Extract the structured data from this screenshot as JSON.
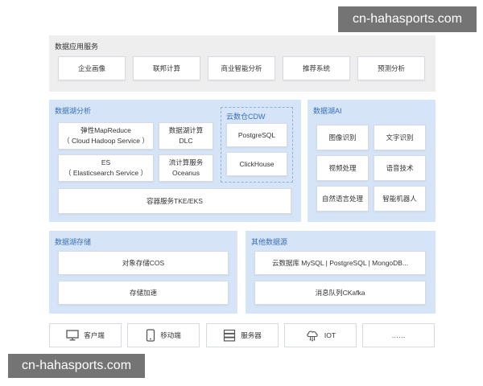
{
  "watermark_top": "cn-hahasports.com",
  "watermark_bottom": "cn-hahasports.com",
  "data_app_services": {
    "title": "数据应用服务",
    "items": [
      "企业画像",
      "联邦计算",
      "商业智能分析",
      "推荐系统",
      "预测分析"
    ]
  },
  "lake_analysis": {
    "title": "数据湖分析",
    "mapreduce": {
      "line1": "弹性MapReduce",
      "line2": "（ Cloud Hadoop Service ）"
    },
    "dlc": {
      "line1": "数据湖计算",
      "line2": "DLC"
    },
    "es": {
      "line1": "ES",
      "line2": "（ Elasticsearch Service ）"
    },
    "oceanus": {
      "line1": "流计算服务",
      "line2": "Oceanus"
    },
    "cdw": {
      "title": "云数仓CDW",
      "items": [
        "PostgreSQL",
        "ClickHouse"
      ]
    },
    "container": "容器服务TKE/EKS"
  },
  "lake_ai": {
    "title": "数据湖AI",
    "items": [
      "图像识别",
      "文字识别",
      "视频处理",
      "语音技术",
      "自然语言处理",
      "智能机器人"
    ]
  },
  "lake_storage": {
    "title": "数据湖存储",
    "items": [
      "对象存储COS",
      "存储加速"
    ]
  },
  "other_sources": {
    "title": "其他数据源",
    "items": [
      "云数据库 MySQL | PostgreSQL | MongoDB...",
      "消息队列CKafka"
    ]
  },
  "clients": [
    {
      "label": "客户端",
      "icon": "monitor-icon"
    },
    {
      "label": "移动端",
      "icon": "mobile-icon"
    },
    {
      "label": "服务器",
      "icon": "server-icon"
    },
    {
      "label": "IOT",
      "icon": "iot-cloud-icon"
    },
    {
      "label": "……",
      "icon": ""
    }
  ]
}
